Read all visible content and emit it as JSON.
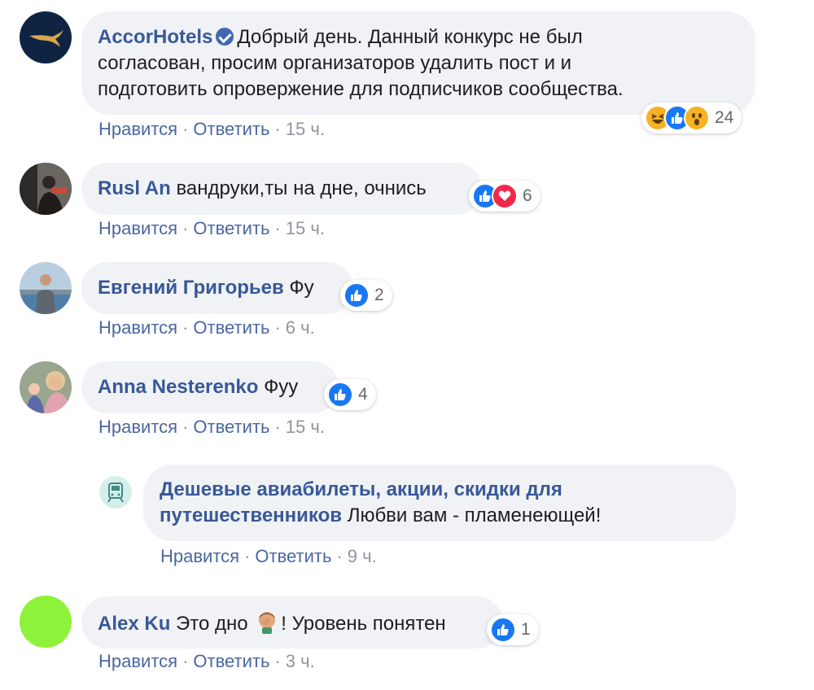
{
  "labels": {
    "like": "Нравится",
    "reply": "Ответить",
    "dot": "·"
  },
  "colors": {
    "link": "#385898",
    "bubble": "#f0f2f5",
    "like": "#1877f2",
    "love": "#f0284a",
    "haha": "#f7b125",
    "alex_avatar": "#8ef13a"
  },
  "comments": [
    {
      "author": "AccorHotels",
      "verified": true,
      "text": "Добрый день. Данный конкурс не был согласован, просим организаторов удалить пост и и подготовить опровержение для подписчиков сообщества.",
      "lines": [
        "Добрый день. Данный конкурс не был",
        "согласован, просим организаторов удалить пост и и",
        "подготовить опровержение для подписчиков сообщества."
      ],
      "time": "15 ч.",
      "reactions": [
        "haha-icon",
        "like-icon",
        "wow-icon"
      ],
      "reaction_count": "24"
    },
    {
      "author": "Rusl An",
      "text": "вандруки,ты на дне, очнись",
      "time": "15 ч.",
      "reactions": [
        "like-icon",
        "love-icon"
      ],
      "reaction_count": "6"
    },
    {
      "author": "Евгений Григорьев",
      "text": "Фу",
      "time": "6 ч.",
      "reactions": [
        "like-icon"
      ],
      "reaction_count": "2"
    },
    {
      "author": "Anna Nesterenko",
      "text": "Фуу",
      "time": "15 ч.",
      "reactions": [
        "like-icon"
      ],
      "reaction_count": "4"
    },
    {
      "author": "Дешевые авиабилеты, акции, скидки для путешественников",
      "author_lines": [
        "Дешевые авиабилеты, акции, скидки для",
        "путешественников"
      ],
      "text": "Любви вам - пламенеющей!",
      "time": "9 ч.",
      "reply": true
    },
    {
      "author": "Alex Ku",
      "text_before": "Это дно",
      "emoji": "facepalm-emoji",
      "text_after": "! Уровень понятен",
      "time": "3 ч.",
      "reactions": [
        "like-icon"
      ],
      "reaction_count": "1"
    }
  ]
}
